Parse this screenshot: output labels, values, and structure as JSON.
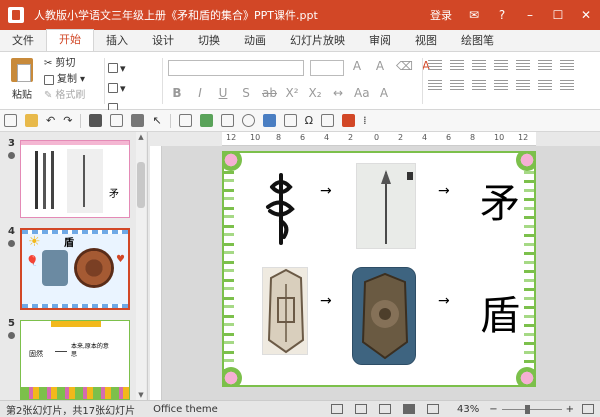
{
  "window": {
    "title": "人教版小学语文三年级上册《矛和盾的集合》PPT课件.ppt",
    "login": "登录"
  },
  "menu": {
    "tabs": [
      "文件",
      "开始",
      "插入",
      "设计",
      "切换",
      "动画",
      "幻灯片放映",
      "审阅",
      "视图",
      "绘图笔"
    ],
    "active": "开始"
  },
  "ribbon": {
    "paste": "粘贴",
    "cut": "剪切",
    "copy": "复制",
    "format_painter": "格式刷"
  },
  "ruler": {
    "h_ticks": [
      "12",
      "10",
      "8",
      "6",
      "4",
      "2",
      "0",
      "2",
      "4",
      "6",
      "8",
      "10",
      "12"
    ]
  },
  "thumbnails": [
    {
      "num": "3",
      "char": "矛"
    },
    {
      "num": "4",
      "title": "盾"
    },
    {
      "num": "5",
      "header": "",
      "text1": "固然",
      "text2": "本来,原本的意思"
    }
  ],
  "slide": {
    "char_mao": "矛",
    "char_dun": "盾",
    "arrow": "→"
  },
  "status": {
    "slide_info": "第2张幻灯片，共17张幻灯片",
    "theme": "Office theme",
    "zoom": "43%",
    "zoom_fraction": 0.43
  },
  "colors": {
    "accent": "#d24726",
    "vine_green": "#7cc04b"
  }
}
